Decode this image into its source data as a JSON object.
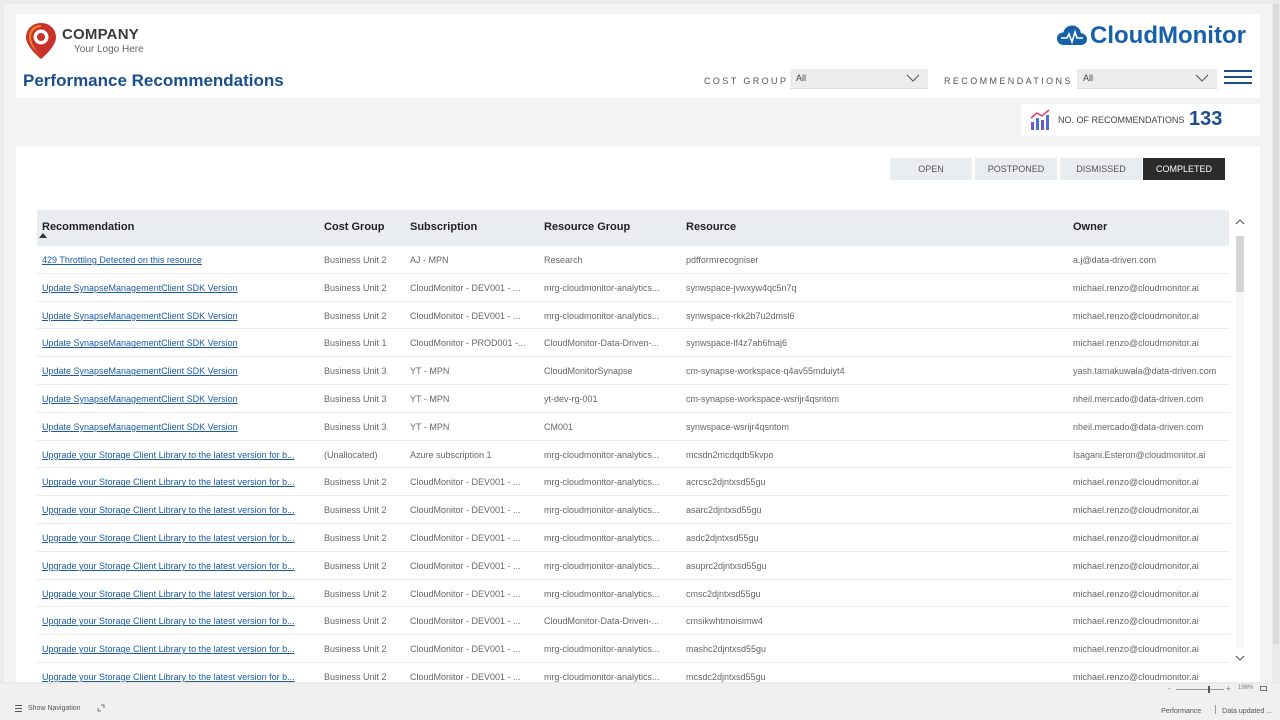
{
  "header": {
    "company": "COMPANY",
    "tagline": "Your Logo Here",
    "page_title": "Performance Recommendations",
    "brand": "CloudMonitor"
  },
  "filters": {
    "cost_group_label": "COST GROUP",
    "cost_group_value": "All",
    "recommendations_label": "RECOMMENDATIONS",
    "recommendations_value": "All"
  },
  "kpi": {
    "label": "NO. OF RECOMMENDATIONS",
    "value": "133"
  },
  "tabs": [
    {
      "label": "OPEN"
    },
    {
      "label": "POSTPONED"
    },
    {
      "label": "DISMISSED"
    },
    {
      "label": "COMPLETED"
    }
  ],
  "table": {
    "columns": [
      "Recommendation",
      "Cost Group",
      "Subscription",
      "Resource Group",
      "Resource",
      "Owner"
    ],
    "rows": [
      [
        "429 Throttling Detected on this resource",
        "Business Unit 2",
        "AJ - MPN",
        "Research",
        "pdfformrecogniser",
        "a.j@data-driven.com"
      ],
      [
        "Update SynapseManagementClient SDK Version",
        "Business Unit 2",
        "CloudMonitor - DEV001 - ...",
        "mrg-cloudmonitor-analytics...",
        "synwspace-jvwxyw4qc5n7q",
        "michael.renzo@cloudmonitor.ai"
      ],
      [
        "Update SynapseManagementClient SDK Version",
        "Business Unit 2",
        "CloudMonitor - DEV001 - ...",
        "mrg-cloudmonitor-analytics...",
        "synwspace-rkk2b7u2dmsl6",
        "michael.renzo@cloudmonitor.ai"
      ],
      [
        "Update SynapseManagementClient SDK Version",
        "Business Unit 1",
        "CloudMonitor - PROD001 -...",
        "CloudMonitor-Data-Driven-...",
        "synwspace-lf4z7ah6fnaj6",
        "michael.renzo@cloudmonitor.ai"
      ],
      [
        "Update SynapseManagementClient SDK Version",
        "Business Unit 3",
        "YT - MPN",
        "CloudMonitorSynapse",
        "cm-synapse-workspace-q4av55mduiyt4",
        "yash.tamakuwala@data-driven.com"
      ],
      [
        "Update SynapseManagementClient SDK Version",
        "Business Unit 3",
        "YT - MPN",
        "yt-dev-rg-001",
        "cm-synapse-workspace-wsrijr4qsntom",
        "nheil.mercado@data-driven.com"
      ],
      [
        "Update SynapseManagementClient SDK Version",
        "Business Unit 3",
        "YT - MPN",
        "CM001",
        "synwspace-wsrijr4qsntom",
        "nheil.mercado@data-driven.com"
      ],
      [
        "Upgrade your Storage Client Library to the latest version for b...",
        "(Unallocated)",
        "Azure subscription 1",
        "mrg-cloudmonitor-analytics...",
        "mcsdn2mcdqdb5kvpo",
        "Isagani.Esteron@cloudmonitor.ai"
      ],
      [
        "Upgrade your Storage Client Library to the latest version for b...",
        "Business Unit 2",
        "CloudMonitor - DEV001 - ...",
        "mrg-cloudmonitor-analytics...",
        "acrcsc2djntxsd55gu",
        "michael.renzo@cloudmonitor.ai"
      ],
      [
        "Upgrade your Storage Client Library to the latest version for b...",
        "Business Unit 2",
        "CloudMonitor - DEV001 - ...",
        "mrg-cloudmonitor-analytics...",
        "asarc2djntxsd55gu",
        "michael.renzo@cloudmonitor.ai"
      ],
      [
        "Upgrade your Storage Client Library to the latest version for b...",
        "Business Unit 2",
        "CloudMonitor - DEV001 - ...",
        "mrg-cloudmonitor-analytics...",
        "asdc2djntxsd55gu",
        "michael.renzo@cloudmonitor.ai"
      ],
      [
        "Upgrade your Storage Client Library to the latest version for b...",
        "Business Unit 2",
        "CloudMonitor - DEV001 - ...",
        "mrg-cloudmonitor-analytics...",
        "asuprc2djntxsd55gu",
        "michael.renzo@cloudmonitor.ai"
      ],
      [
        "Upgrade your Storage Client Library to the latest version for b...",
        "Business Unit 2",
        "CloudMonitor - DEV001 - ...",
        "mrg-cloudmonitor-analytics...",
        "cmsc2djntxsd55gu",
        "michael.renzo@cloudmonitor.ai"
      ],
      [
        "Upgrade your Storage Client Library to the latest version for b...",
        "Business Unit 2",
        "CloudMonitor - DEV001 - ...",
        "CloudMonitor-Data-Driven-...",
        "cmsikwhtmoisimw4",
        "michael.renzo@cloudmonitor.ai"
      ],
      [
        "Upgrade your Storage Client Library to the latest version for b...",
        "Business Unit 2",
        "CloudMonitor - DEV001 - ...",
        "mrg-cloudmonitor-analytics...",
        "mashc2djntxsd55gu",
        "michael.renzo@cloudmonitor.ai"
      ],
      [
        "Upgrade your Storage Client Library to the latest version for b...",
        "Business Unit 2",
        "CloudMonitor - DEV001 - ...",
        "mrg-cloudmonitor-analytics...",
        "mcsdc2djntxsd55gu",
        "michael.renzo@cloudmonitor.ai"
      ]
    ]
  },
  "status_bar": {
    "show_navigation": "Show Navigation",
    "zoom_minus": "-",
    "zoom_plus": "+",
    "zoom": "196%",
    "page_name": "Performance",
    "data_updated": "Data updated ..."
  },
  "icons": {
    "logo": "location-pin-icon",
    "brand": "cloud-pulse-icon",
    "kpi": "bar-chart-icon",
    "menu": "hamburger-menu-icon",
    "sort": "sort-ascending-icon"
  },
  "colors": {
    "primary": "#1a4e8c",
    "brand": "#1560a8",
    "link": "#1a5ca8",
    "logo_orange": "#f08a24",
    "logo_red": "#c8332b",
    "active_tab": "#2b2b2b"
  }
}
